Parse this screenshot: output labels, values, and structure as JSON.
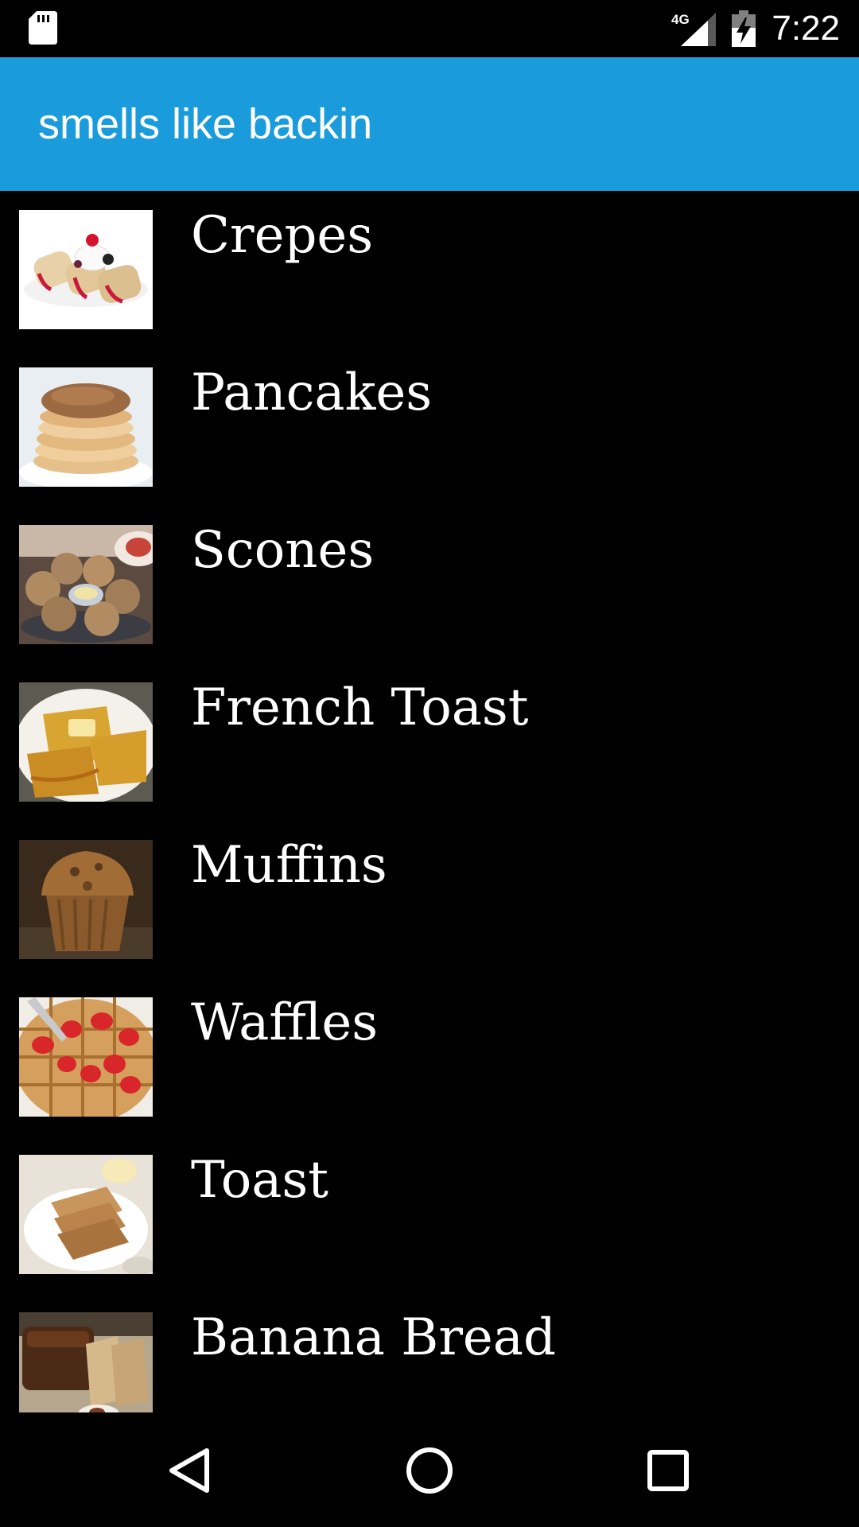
{
  "status_bar": {
    "network": "4G",
    "time": "7:22",
    "icons": [
      "sd-card-icon",
      "signal-icon",
      "battery-charging-icon"
    ]
  },
  "app_bar": {
    "title": "smells like backin"
  },
  "items": [
    {
      "label": "Crepes",
      "thumb_icon": "crepes-photo"
    },
    {
      "label": "Pancakes",
      "thumb_icon": "pancakes-photo"
    },
    {
      "label": "Scones",
      "thumb_icon": "scones-photo"
    },
    {
      "label": "French Toast",
      "thumb_icon": "french-toast-photo"
    },
    {
      "label": "Muffins",
      "thumb_icon": "muffin-photo"
    },
    {
      "label": "Waffles",
      "thumb_icon": "waffles-photo"
    },
    {
      "label": "Toast",
      "thumb_icon": "toast-photo"
    },
    {
      "label": "Banana Bread",
      "thumb_icon": "banana-bread-photo"
    }
  ],
  "nav_bar": {
    "icons": [
      "back-icon",
      "home-icon",
      "recents-icon"
    ]
  },
  "colors": {
    "app_bar": "#1a9bdb",
    "background": "#000000",
    "text": "#ffffff"
  }
}
